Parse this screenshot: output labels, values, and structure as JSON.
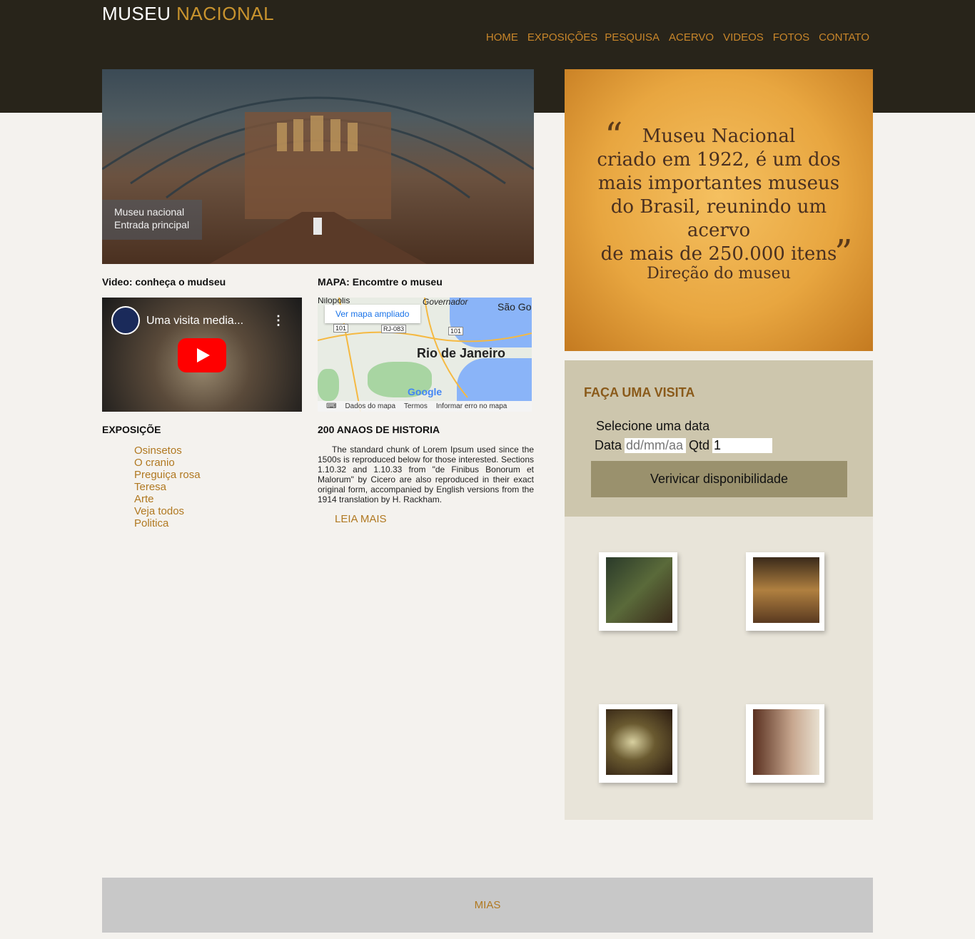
{
  "header": {
    "logo_word1": "MUSEU",
    "logo_word2": "NACIONAL",
    "nav": [
      "HOME",
      "EXPOSIÇÕES",
      "PESQUISA",
      "ACERVO",
      "VIDEOS",
      "FOTOS",
      "CONTATO"
    ]
  },
  "hero": {
    "caption_line1": "Museu nacional",
    "caption_line2": "Entrada principal"
  },
  "video_section": {
    "title": "Video: conheça o mudseu",
    "video_title": "Uma visita media...",
    "more_icon": "⋮"
  },
  "map_section": {
    "title": "MAPA: Encomtre o museu",
    "button": "Ver mapa ampliado",
    "city": "Rio de Janeiro",
    "place_top_left": "Nilopolis",
    "place_top_mid": "Governador",
    "place_top_right": "São Go",
    "road1": "101",
    "road2": "RJ-083",
    "road3": "101",
    "google": "Google",
    "footer_data": "Dados do mapa",
    "footer_terms": "Termos",
    "footer_report": "Informar erro no mapa"
  },
  "expo_section": {
    "title": "EXPOSIÇÕE",
    "items": [
      "Osinsetos",
      "O cranio",
      "Preguiça rosa",
      "Teresa",
      "Arte",
      "Veja todos",
      "Politica"
    ]
  },
  "history_section": {
    "title": "200 ANAOS DE HISTORIA",
    "text": "The standard chunk of Lorem Ipsum used since the 1500s is reproduced below for those interested. Sections 1.10.32 and 1.10.33 from \"de Finibus Bonorum et Malorum\" by Cicero are also reproduced in their exact original form, accompanied by English versions from the 1914 translation by H. Rackham.",
    "read_more": "LEIA MAIS"
  },
  "quote": {
    "open": "“",
    "close": "”",
    "line1": "Museu Nacional",
    "line2": "criado em 1922, é um dos",
    "line3": "mais importantes museus",
    "line4": "do Brasil, reunindo um acervo",
    "line5": "de mais de 250.000 itens",
    "signature": "Direção do museu"
  },
  "visit": {
    "title": "FAÇA UMA VISITA",
    "select_label": "Selecione uma data",
    "date_label": "Data",
    "date_placeholder": "dd/mm/aa",
    "qtd_label": "Qtd",
    "qtd_value": "1",
    "button": "Verivicar disponibilidade"
  },
  "footer": {
    "text": "MIAS"
  },
  "colors": {
    "header_bg": "#28241a",
    "accent": "#c8862a",
    "link": "#b07820"
  }
}
